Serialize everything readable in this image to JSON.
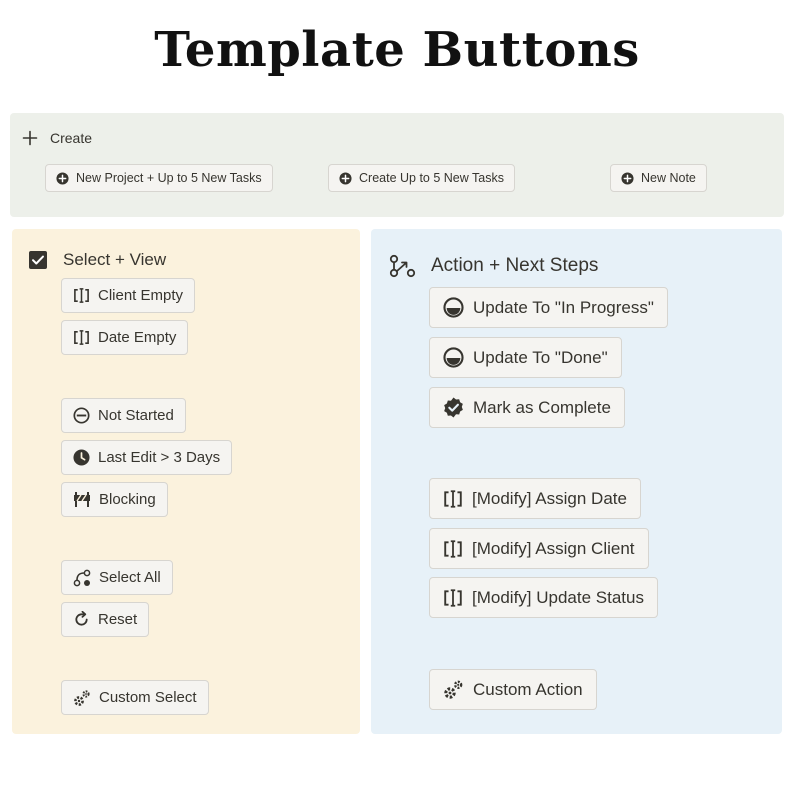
{
  "page_title": "Template Buttons",
  "colors": {
    "create_panel_bg": "#edf0ea",
    "select_panel_bg": "#fbf2dd",
    "action_panel_bg": "#e7f1f8",
    "button_bg": "#f5f4f1",
    "icon": "#37352f"
  },
  "create": {
    "header_icon": "plus-icon",
    "header_label": "Create",
    "buttons": [
      {
        "icon": "plus-circle-icon",
        "label": "New Project + Up to 5 New Tasks"
      },
      {
        "icon": "plus-circle-icon",
        "label": "Create Up to 5 New Tasks"
      },
      {
        "icon": "plus-circle-icon",
        "label": "New Note"
      }
    ]
  },
  "select_view": {
    "header_icon": "checkbox-checked-icon",
    "header_label": "Select + View",
    "buttons": [
      {
        "icon": "select-bracket-icon",
        "label": "Client Empty"
      },
      {
        "icon": "select-bracket-icon",
        "label": "Date Empty"
      },
      {
        "icon": "gauge-empty-icon",
        "label": "Not Started"
      },
      {
        "icon": "clock-icon",
        "label": "Last Edit > 3 Days"
      },
      {
        "icon": "barrier-icon",
        "label": "Blocking"
      },
      {
        "icon": "select-all-icon",
        "label": "Select All"
      },
      {
        "icon": "reset-icon",
        "label": "Reset"
      },
      {
        "icon": "gears-icon",
        "label": "Custom Select"
      }
    ]
  },
  "action": {
    "header_icon": "flow-icon",
    "header_label": "Action + Next Steps",
    "buttons": [
      {
        "icon": "gauge-half-icon",
        "label": "Update To \"In Progress\""
      },
      {
        "icon": "gauge-half-icon",
        "label": "Update To \"Done\""
      },
      {
        "icon": "verified-badge-icon",
        "label": "Mark as Complete"
      },
      {
        "icon": "select-bracket-icon",
        "label": "[Modify] Assign Date"
      },
      {
        "icon": "select-bracket-icon",
        "label": "[Modify] Assign Client"
      },
      {
        "icon": "select-bracket-icon",
        "label": "[Modify] Update Status"
      },
      {
        "icon": "gears-icon",
        "label": "Custom Action"
      }
    ]
  }
}
